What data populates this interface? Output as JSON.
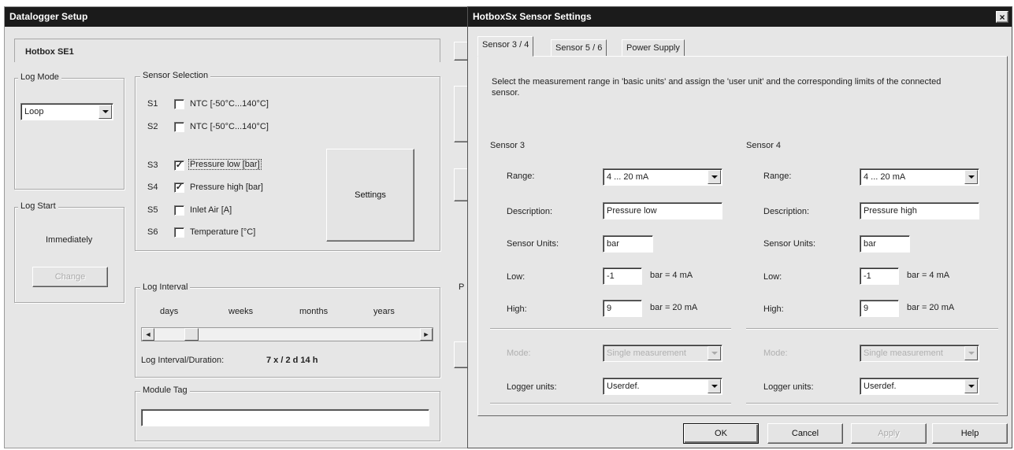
{
  "datalogger": {
    "title": "Datalogger Setup",
    "device_tab": "Hotbox SE1",
    "log_mode": {
      "label": "Log Mode",
      "value": "Loop"
    },
    "sensor_selection": {
      "label": "Sensor Selection",
      "sensors": [
        {
          "id": "S1",
          "name": "NTC [-50°C...140°C]",
          "checked": false,
          "mark": ""
        },
        {
          "id": "S2",
          "name": "NTC [-50°C...140°C]",
          "checked": false,
          "mark": ""
        },
        {
          "id": "S3",
          "name": "Pressure low [bar]",
          "checked": true,
          "mark": "✓"
        },
        {
          "id": "S4",
          "name": "Pressure high [bar]",
          "checked": true,
          "mark": "✓"
        },
        {
          "id": "S5",
          "name": "Inlet Air [A]",
          "checked": false,
          "mark": ""
        },
        {
          "id": "S6",
          "name": "Temperature [°C]",
          "checked": false,
          "mark": ""
        }
      ],
      "settings_button": "Settings"
    },
    "log_start": {
      "label": "Log Start",
      "value": "Immediately",
      "change_button": "Change"
    },
    "log_interval": {
      "label": "Log Interval",
      "scale": [
        "days",
        "weeks",
        "months",
        "years"
      ],
      "duration_label": "Log Interval/Duration:",
      "duration_value": "7 x / 2 d 14 h"
    },
    "module_tag": {
      "label": "Module Tag",
      "value": ""
    },
    "partial_label": "P"
  },
  "sensor_settings": {
    "title": "HotboxSx Sensor Settings",
    "close_glyph": "×",
    "tabs": [
      "Sensor 3 / 4",
      "Sensor 5 / 6",
      "Power Supply"
    ],
    "instructions": "Select the measurement range in 'basic units' and assign the 'user unit' and the corresponding limits of the connected sensor.",
    "labels": {
      "range": "Range:",
      "description": "Description:",
      "sensor_units": "Sensor Units:",
      "low": "Low:",
      "high": "High:",
      "mode": "Mode:",
      "logger_units": "Logger units:"
    },
    "sensors": [
      {
        "title": "Sensor 3",
        "range": "4 ... 20 mA",
        "description": "Pressure low",
        "sensor_units": "bar",
        "low": "-1",
        "low_suffix": "bar = 4 mA",
        "high": "9",
        "high_suffix": "bar = 20 mA",
        "mode": "Single measurement",
        "logger_units": "Userdef."
      },
      {
        "title": "Sensor 4",
        "range": "4 ... 20 mA",
        "description": "Pressure high",
        "sensor_units": "bar",
        "low": "-1",
        "low_suffix": "bar = 4 mA",
        "high": "9",
        "high_suffix": "bar = 20 mA",
        "mode": "Single measurement",
        "logger_units": "Userdef."
      }
    ],
    "buttons": {
      "ok": "OK",
      "cancel": "Cancel",
      "apply": "Apply",
      "help": "Help"
    }
  }
}
